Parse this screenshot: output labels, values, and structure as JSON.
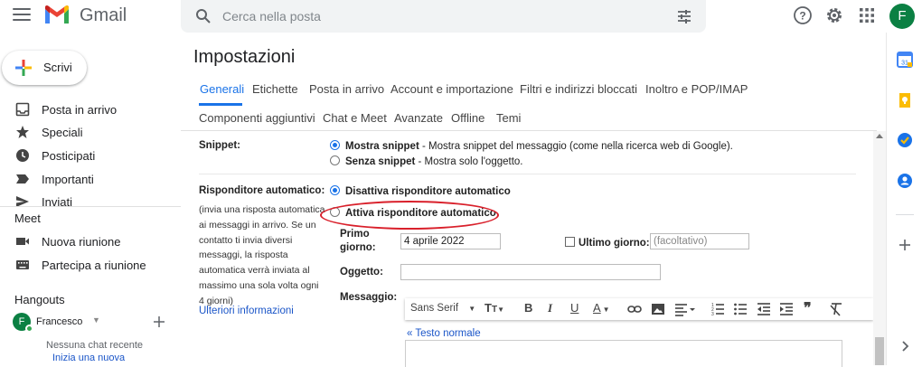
{
  "app": {
    "name": "Gmail",
    "user_initial": "F"
  },
  "search": {
    "placeholder": "Cerca nella posta"
  },
  "compose": {
    "label": "Scrivi"
  },
  "nav": {
    "items": [
      {
        "label": "Posta in arrivo",
        "icon": "inbox-icon"
      },
      {
        "label": "Speciali",
        "icon": "star-icon"
      },
      {
        "label": "Posticipati",
        "icon": "clock-icon"
      },
      {
        "label": "Importanti",
        "icon": "important-icon"
      },
      {
        "label": "Inviati",
        "icon": "send-icon"
      }
    ]
  },
  "meet": {
    "title": "Meet",
    "items": [
      {
        "label": "Nuova riunione",
        "icon": "video-icon"
      },
      {
        "label": "Partecipa a riunione",
        "icon": "keyboard-icon"
      }
    ]
  },
  "hangouts": {
    "title": "Hangouts",
    "user": "Francesco",
    "no_chats": "Nessuna chat recente",
    "start_link": "Inizia una nuova"
  },
  "page": {
    "title": "Impostazioni"
  },
  "tabs": {
    "row1": [
      "Generali",
      "Etichette",
      "Posta in arrivo",
      "Account e importazione",
      "Filtri e indirizzi bloccati",
      "Inoltro e POP/IMAP"
    ],
    "row2": [
      "Componenti aggiuntivi",
      "Chat e Meet",
      "Avanzate",
      "Offline",
      "Temi"
    ],
    "active": "Generali"
  },
  "snippet": {
    "label": "Snippet:",
    "options": [
      {
        "bold": "Mostra snippet",
        "rest": " - Mostra snippet del messaggio (come nella ricerca web di Google).",
        "checked": true
      },
      {
        "bold": "Senza snippet",
        "rest": " - Mostra solo l'oggetto.",
        "checked": false
      }
    ]
  },
  "auto_reply": {
    "label": "Risponditore automatico:",
    "description": "(invia una risposta automatica ai messaggi in arrivo. Se un contatto ti invia diversi messaggi, la risposta automatica verrà inviata al massimo una sola volta ogni 4 giorni)",
    "more_link": "Ulteriori informazioni",
    "options": [
      {
        "label": "Disattiva risponditore automatico",
        "checked": true
      },
      {
        "label": "Attiva risponditore automatico",
        "checked": false
      }
    ],
    "first_day_label_1": "Primo",
    "first_day_label_2": "giorno:",
    "first_day_value": "4 aprile 2022",
    "last_day_label": "Ultimo giorno:",
    "last_day_placeholder": "(facoltativo)",
    "subject_label": "Oggetto:",
    "subject_value": "",
    "message_label": "Messaggio:",
    "plain_text_link": "« Testo normale"
  },
  "editor_toolbar": {
    "font": "Sans Serif"
  },
  "colors": {
    "accent": "#1a73e8",
    "highlight_ellipse": "#d9202b",
    "avatar": "#0b8043"
  }
}
